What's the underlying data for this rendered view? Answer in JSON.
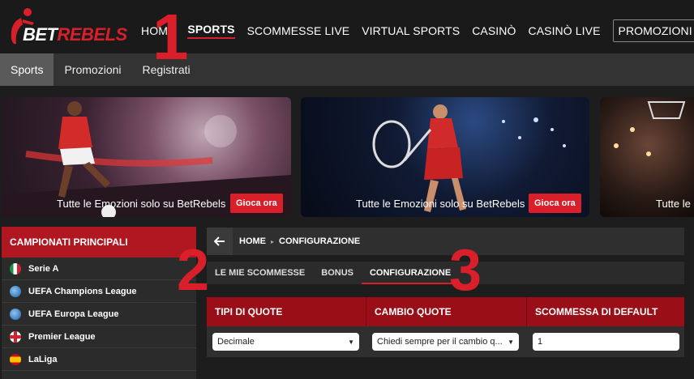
{
  "brand": {
    "bet": "BET",
    "rebels": "REBELS"
  },
  "main_nav": [
    {
      "label": "HOME"
    },
    {
      "label": "SPORTS"
    },
    {
      "label": "SCOMMESSE LIVE"
    },
    {
      "label": "VIRTUAL SPORTS"
    },
    {
      "label": "CASINÒ"
    },
    {
      "label": "CASINÒ LIVE"
    },
    {
      "label": "PROMOZIONI"
    }
  ],
  "annotations": {
    "n1": "1",
    "n2": "2",
    "n3": "3"
  },
  "sub_nav": [
    {
      "label": "Sports"
    },
    {
      "label": "Promozioni"
    },
    {
      "label": "Registrati"
    }
  ],
  "banners": [
    {
      "caption": "Tutte le Emozioni solo su BetRebels",
      "button": "Gioca ora"
    },
    {
      "caption": "Tutte le Emozioni solo su BetRebels",
      "button": "Gioca ora"
    },
    {
      "caption": "Tutte le E"
    }
  ],
  "sidebar": {
    "title": "CAMPIONATI PRINCIPALI",
    "leagues": [
      {
        "label": "Serie A",
        "icon": "italy-flag-icon"
      },
      {
        "label": "UEFA Champions League",
        "icon": "globe-icon"
      },
      {
        "label": "UEFA Europa League",
        "icon": "globe-icon"
      },
      {
        "label": "Premier League",
        "icon": "england-flag-icon"
      },
      {
        "label": "LaLiga",
        "icon": "spain-flag-icon"
      }
    ]
  },
  "breadcrumb": {
    "home": "HOME",
    "current": "CONFIGURAZIONE"
  },
  "tabs": [
    {
      "label": "LE MIE SCOMMESSE"
    },
    {
      "label": "BONUS"
    },
    {
      "label": "CONFIGURAZIONE"
    }
  ],
  "config": {
    "headers": [
      "TIPI DI QUOTE",
      "CAMBIO QUOTE",
      "SCOMMESSA DI DEFAULT"
    ],
    "odds_type": "Decimale",
    "odds_change": "Chiedi sempre per il cambio q...",
    "default_stake": "1"
  },
  "colors": {
    "accent": "#d81f2a",
    "header_red": "#9a0f17"
  }
}
